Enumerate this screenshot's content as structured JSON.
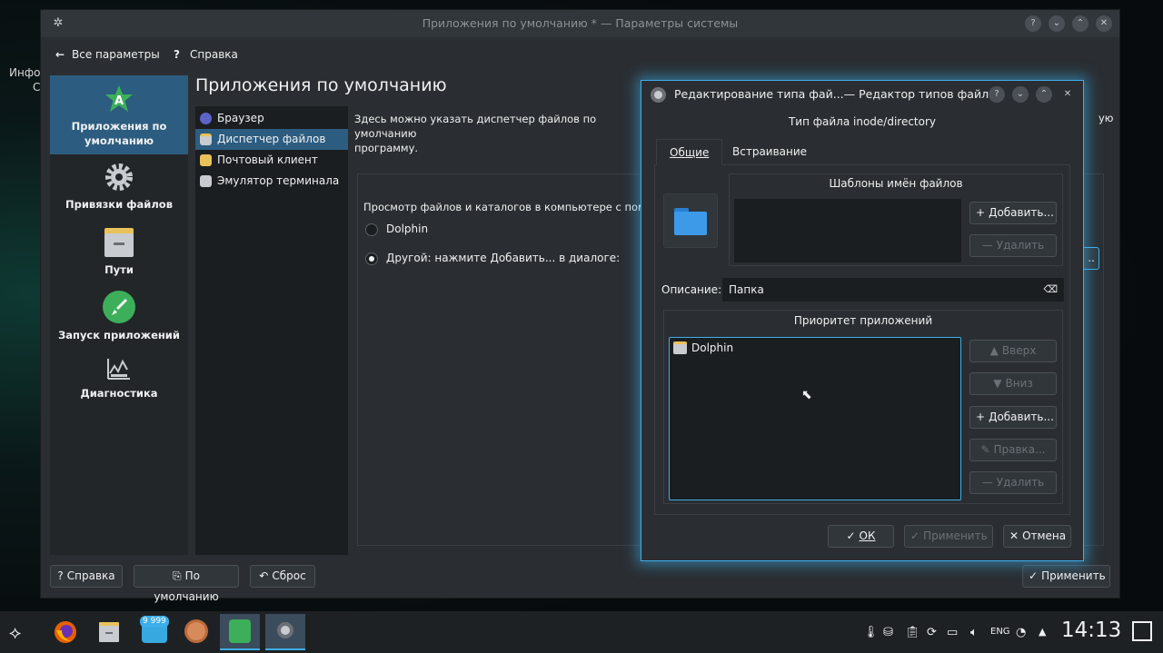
{
  "desktop": {
    "text_line1": "Инфо",
    "text_line2": "С"
  },
  "window": {
    "title": "Приложения по умолчанию * — Параметры системы",
    "toolbar": {
      "all_settings": "Все параметры",
      "help": "Справка"
    },
    "sidebar": [
      {
        "label_line1": "Приложения по",
        "label_line2": "умолчанию",
        "icon": "star-a-icon"
      },
      {
        "label_line1": "Привязки файлов",
        "label_line2": "",
        "icon": "gear-icon"
      },
      {
        "label_line1": "Пути",
        "label_line2": "",
        "icon": "folder-icon"
      },
      {
        "label_line1": "Запуск приложений",
        "label_line2": "",
        "icon": "rocket-icon"
      },
      {
        "label_line1": "Диагностика",
        "label_line2": "",
        "icon": "diagnostics-icon"
      }
    ],
    "page_title": "Приложения по умолчанию",
    "list": [
      "Браузер",
      "Диспетчер файлов",
      "Почтовый клиент",
      "Эмулятор терминала"
    ],
    "description": "Здесь можно указать диспетчер файлов по умолчанию",
    "description_line2": "программу.",
    "description_tail": "ую",
    "group_label": "Просмотр файлов и каталогов в компьютере с помо",
    "radio_dolphin": "Dolphin",
    "radio_other": "Другой: нажмите Добавить... в диалоге:",
    "bottom": {
      "help": "Справка",
      "defaults": "По умолчанию",
      "reset": "Сброс",
      "apply": "Применить"
    }
  },
  "dialog": {
    "title": "Редактирование типа фай...— Редактор типов файлов",
    "file_type": "Тип файла inode/directory",
    "tabs": [
      "Общие",
      "Встраивание"
    ],
    "patterns_title": "Шаблоны имён файлов",
    "add": "Добавить...",
    "remove": "Удалить",
    "description_label": "Описание:",
    "description_value": "Папка",
    "priority_title": "Приоритет приложений",
    "apps": [
      "Dolphin"
    ],
    "up": "Вверх",
    "down": "Вниз",
    "add2": "Добавить...",
    "edit": "Правка...",
    "remove2": "Удалить",
    "ok": "ОК",
    "apply": "Применить",
    "cancel": "Отмена"
  },
  "taskbar": {
    "badge": "9 999",
    "lang": "ENG",
    "time": "14:13"
  },
  "colors": {
    "accent": "#3daee9",
    "window_bg": "#2a2e32",
    "selection": "#2c5d80"
  }
}
